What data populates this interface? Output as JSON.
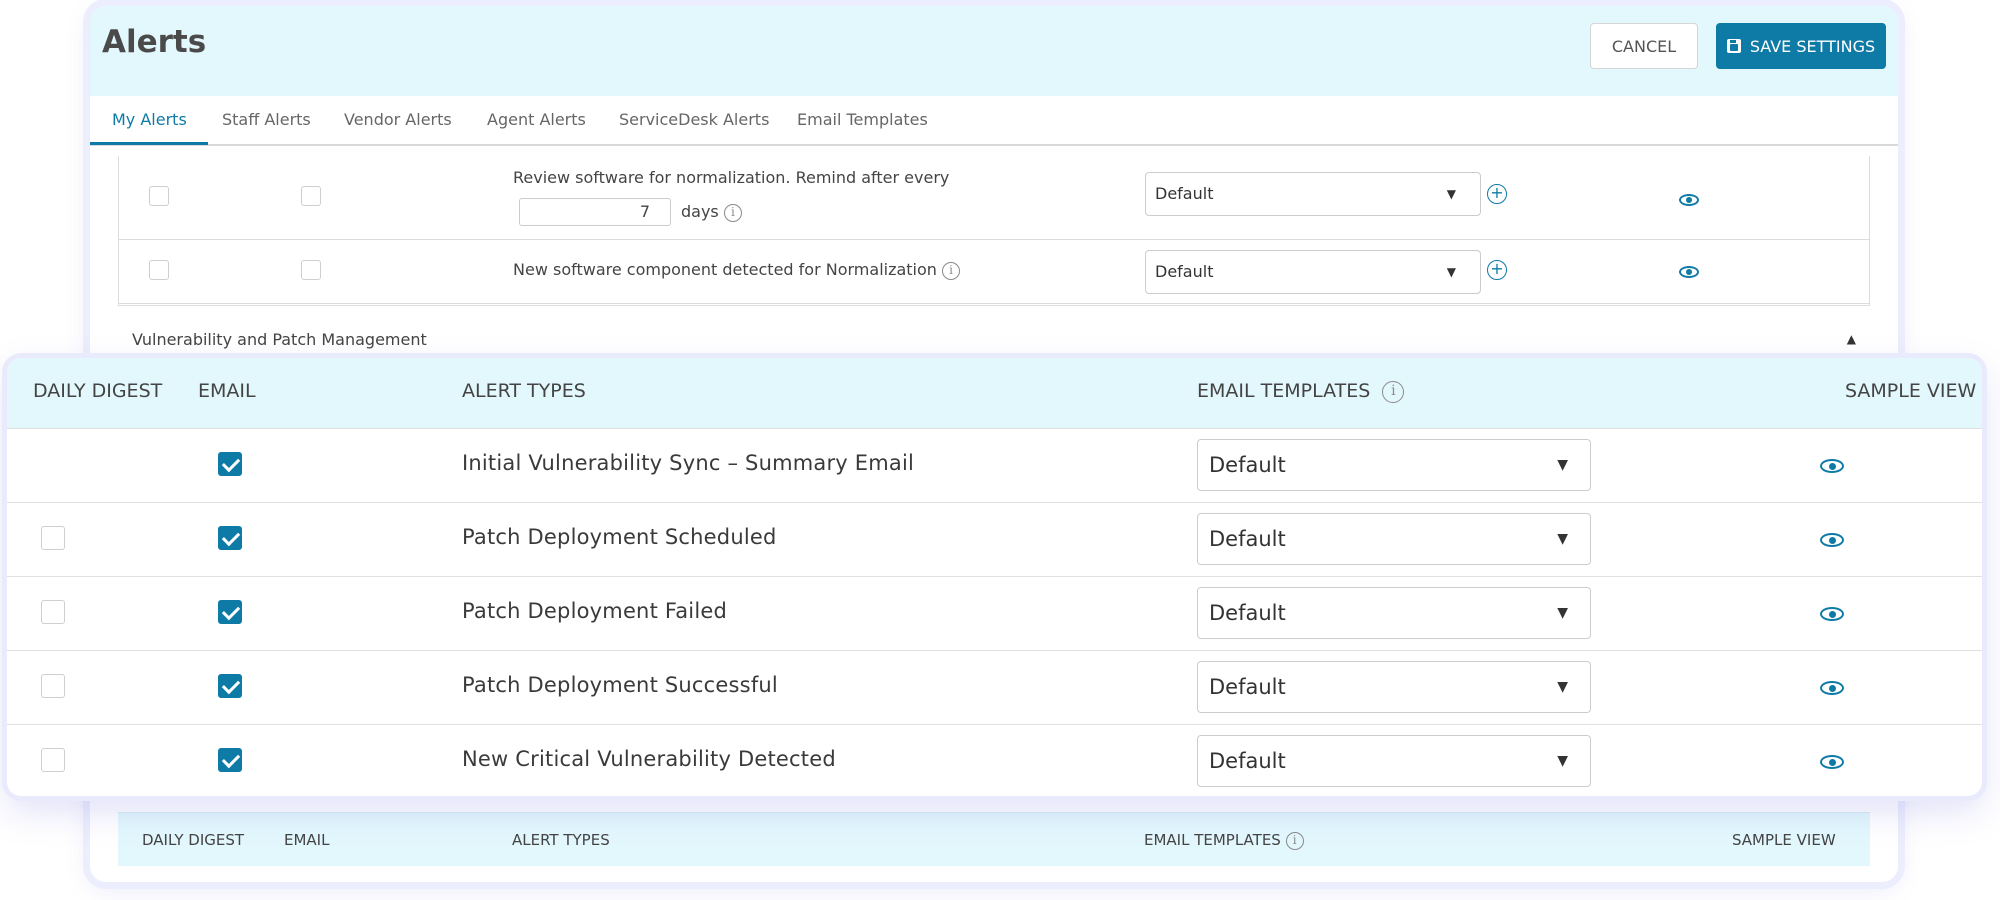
{
  "header": {
    "title": "Alerts",
    "cancel_label": "CANCEL",
    "save_label": "SAVE SETTINGS"
  },
  "tabs": [
    {
      "label": "My Alerts",
      "active": true
    },
    {
      "label": "Staff Alerts",
      "active": false
    },
    {
      "label": "Vendor Alerts",
      "active": false
    },
    {
      "label": "Agent Alerts",
      "active": false
    },
    {
      "label": "ServiceDesk Alerts",
      "active": false
    },
    {
      "label": "Email Templates",
      "active": false
    }
  ],
  "background_rows": [
    {
      "text": "Review software for normalization. Remind after every",
      "remind_value": "7",
      "remind_unit": "days",
      "template": "Default",
      "daily_digest": false,
      "email": false
    },
    {
      "text": "New software component detected for Normalization",
      "template": "Default",
      "daily_digest": false,
      "email": false
    }
  ],
  "section": {
    "label": "Vulnerability and Patch Management",
    "expanded": true
  },
  "columns": {
    "daily_digest": "DAILY DIGEST",
    "email": "EMAIL",
    "alert_types": "ALERT TYPES",
    "email_templates": "EMAIL TEMPLATES",
    "sample_view": "SAMPLE VIEW"
  },
  "alert_rows": [
    {
      "text": "Initial Vulnerability Sync – Summary Email",
      "daily_digest": null,
      "email": true,
      "template": "Default"
    },
    {
      "text": "Patch Deployment Scheduled",
      "daily_digest": false,
      "email": true,
      "template": "Default"
    },
    {
      "text": "Patch Deployment Failed",
      "daily_digest": false,
      "email": true,
      "template": "Default"
    },
    {
      "text": "Patch Deployment Successful",
      "daily_digest": false,
      "email": true,
      "template": "Default"
    },
    {
      "text": "New Critical Vulnerability Detected",
      "daily_digest": false,
      "email": true,
      "template": "Default"
    }
  ],
  "icons": {
    "info": "info-icon",
    "add": "plus-circle-icon",
    "sample_view": "eye-icon",
    "save": "floppy-disk-icon",
    "dropdown": "caret-down-icon",
    "collapse": "caret-up-icon"
  },
  "colors": {
    "accent": "#0e7ba6",
    "header_bg": "#e3f8fd"
  }
}
